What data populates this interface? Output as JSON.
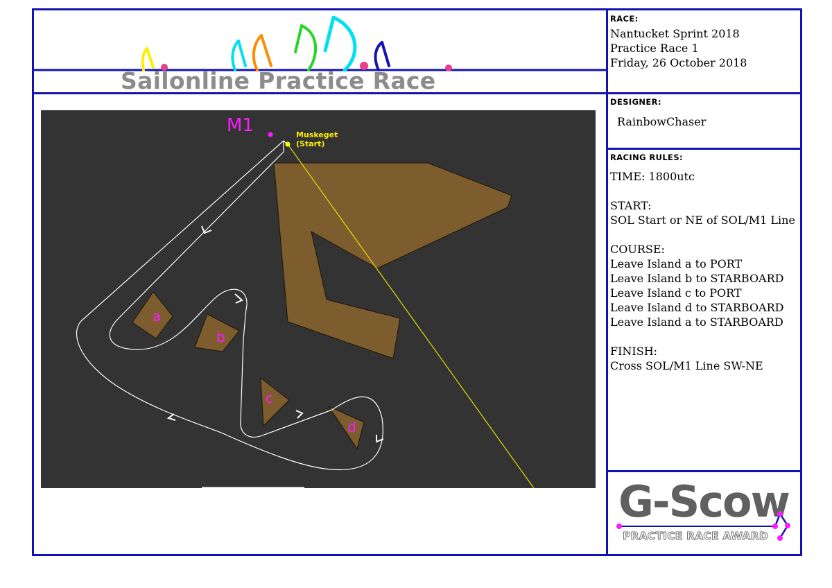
{
  "banner": {
    "title": "Sailonline Practice Race"
  },
  "race": {
    "label": "RACE:",
    "name": "Nantucket Sprint 2018",
    "subtitle": "Practice Race 1",
    "date": "Friday, 26 October 2018"
  },
  "designer": {
    "label": "DESIGNER:",
    "name": "RainbowChaser"
  },
  "rules": {
    "label": "RACING RULES:",
    "lines": [
      "TIME: 1800utc",
      "",
      "START:",
      "SOL Start or NE of SOL/M1 Line",
      "",
      "COURSE:",
      "Leave Island a to PORT",
      "Leave Island b to STARBOARD",
      "Leave Island c to PORT",
      "Leave Island d to STARBOARD",
      "Leave Island a to STARBOARD",
      "",
      "FINISH:",
      "Cross SOL/M1 Line SW-NE"
    ]
  },
  "map": {
    "mark_label": "M1",
    "start_label_1": "Muskeget",
    "start_label_2": "(Start)",
    "islands": [
      "a",
      "b",
      "c",
      "d"
    ],
    "colors": {
      "water": "#333333",
      "land": "#7d5c2d",
      "mark": "#ff1aff",
      "start": "#ffff00",
      "route": "#ffffff"
    }
  },
  "award": {
    "title": "G-Scow",
    "subtitle": "PRACTICE RACE AWARD"
  },
  "colors": {
    "frame": "#1212b4",
    "accent": "#e83e8c"
  }
}
